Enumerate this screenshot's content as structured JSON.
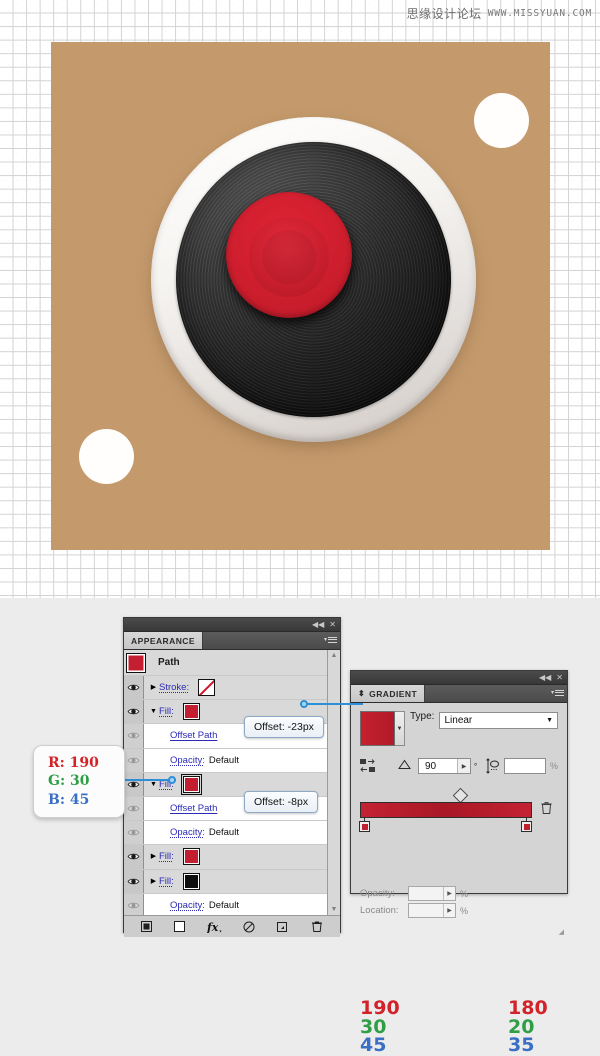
{
  "watermark": {
    "chinese": "思缘设计论坛",
    "url": "WWW.MISSYUAN.COM"
  },
  "artwork": {
    "name": "vinyl-record-illustration",
    "background_color": "#c49a6c",
    "label_color": "#cc1f2d",
    "disc_color": "#1d1d1d",
    "ring_color": "#f2efec",
    "dot_color": "#ffffff"
  },
  "appearance_panel": {
    "titlebar": {
      "collapse": "◀◀",
      "close": "✕"
    },
    "tab_label": "APPEARANCE",
    "header": {
      "title": "Path"
    },
    "rows": [
      {
        "name": "stroke-row",
        "label": "Stroke:",
        "value": "",
        "swatch": "none",
        "triangle": "▶",
        "indent": false,
        "shade": true
      },
      {
        "name": "fill-row-1",
        "label": "Fill:",
        "value": "",
        "swatch": "red",
        "triangle": "▼",
        "indent": false,
        "shade": true
      },
      {
        "name": "offset-path-row-1",
        "label": "Offset Path",
        "value": "",
        "swatch": "",
        "triangle": "",
        "indent": true,
        "shade": false
      },
      {
        "name": "opacity-row-1",
        "label": "Opacity:",
        "value": "Default",
        "swatch": "",
        "triangle": "",
        "indent": true,
        "shade": false
      },
      {
        "name": "fill-row-2",
        "label": "Fill:",
        "value": "",
        "swatch": "red-selected",
        "triangle": "▼",
        "indent": false,
        "shade": true
      },
      {
        "name": "offset-path-row-2",
        "label": "Offset Path",
        "value": "",
        "swatch": "",
        "triangle": "",
        "indent": true,
        "shade": false
      },
      {
        "name": "opacity-row-2",
        "label": "Opacity:",
        "value": "Default",
        "swatch": "",
        "triangle": "",
        "indent": true,
        "shade": false
      },
      {
        "name": "fill-row-3",
        "label": "Fill:",
        "value": "",
        "swatch": "red",
        "triangle": "▶",
        "indent": false,
        "shade": true
      },
      {
        "name": "fill-row-4",
        "label": "Fill:",
        "value": "",
        "swatch": "black",
        "triangle": "▶",
        "indent": false,
        "shade": true
      },
      {
        "name": "opacity-row-3",
        "label": "Opacity:",
        "value": "Default",
        "swatch": "",
        "triangle": "",
        "indent": true,
        "shade": false
      }
    ],
    "footer_buttons": [
      {
        "name": "add-new-stroke-button",
        "glyph": "■"
      },
      {
        "name": "add-new-fill-button",
        "glyph": "□"
      },
      {
        "name": "add-effect-button",
        "glyph": "fx"
      },
      {
        "name": "clear-appearance-button",
        "glyph": "⊘"
      },
      {
        "name": "duplicate-item-button",
        "glyph": "❐"
      },
      {
        "name": "delete-item-button",
        "glyph": "🗑"
      }
    ]
  },
  "tooltips": {
    "offset_1": "Offset: -23px",
    "offset_2": "Offset: -8px"
  },
  "rgb_callout": {
    "r": "R: 190",
    "g": "G: 30",
    "b": "B: 45"
  },
  "gradient_panel": {
    "titlebar": {
      "collapse": "◀◀",
      "close": "✕"
    },
    "tab_label": "GRADIENT",
    "type": {
      "label": "Type:",
      "value": "Linear"
    },
    "angle": {
      "value": "90",
      "unit": "°"
    },
    "aspect_ratio": {
      "value": "",
      "unit": "%"
    },
    "opacity": {
      "label": "Opacity:",
      "value": "",
      "unit": "%"
    },
    "location": {
      "label": "Location:",
      "value": "",
      "unit": "%"
    },
    "stops": [
      {
        "name": "gradient-stop-left",
        "position": "0%",
        "r": "190",
        "g": "30",
        "b": "45"
      },
      {
        "name": "gradient-stop-right",
        "position": "100%",
        "r": "180",
        "g": "20",
        "b": "35"
      }
    ],
    "colors": {
      "red": "#d2232a",
      "green": "#2f9e45",
      "blue": "#3b6fc4"
    }
  }
}
